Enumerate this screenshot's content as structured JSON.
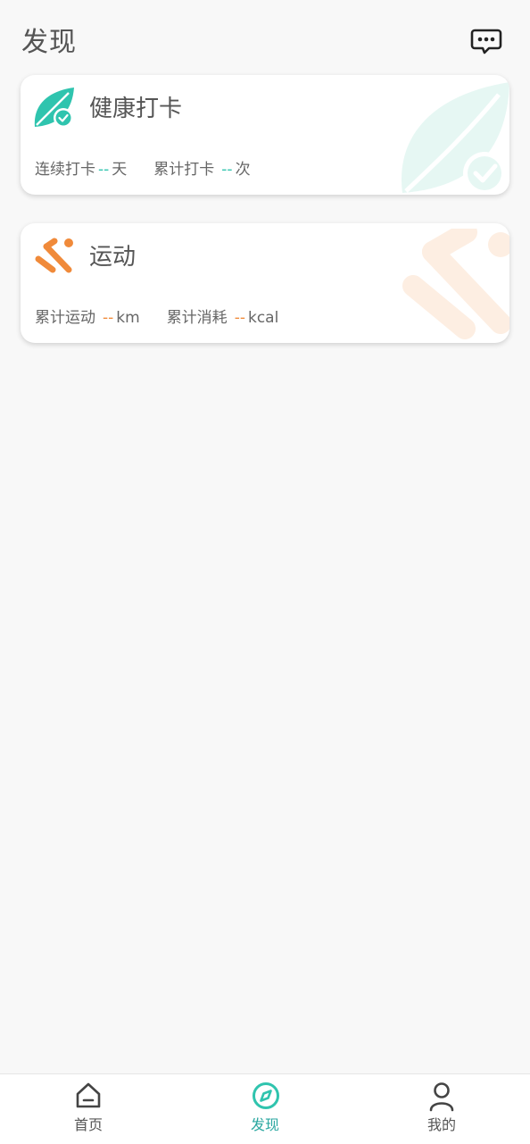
{
  "header": {
    "title": "发现",
    "message_icon": "chat-bubble-icon"
  },
  "cards": {
    "health": {
      "title": "健康打卡",
      "icon": "leaf-check-icon",
      "accent": "#2fc4ae",
      "stats": [
        {
          "label": "连续打卡",
          "value": "--",
          "unit": "天"
        },
        {
          "label": "累计打卡",
          "value": "--",
          "unit": "次"
        }
      ]
    },
    "sport": {
      "title": "运动",
      "icon": "running-icon",
      "accent": "#f08a3a",
      "stats": [
        {
          "label": "累计运动",
          "value": "--",
          "unit": "km"
        },
        {
          "label": "累计消耗",
          "value": "--",
          "unit": "kcal"
        }
      ]
    }
  },
  "tabbar": {
    "active": "发现",
    "active_color": "#2aa7a0",
    "items": [
      {
        "label": "首页",
        "icon": "home-icon"
      },
      {
        "label": "发现",
        "icon": "compass-icon"
      },
      {
        "label": "我的",
        "icon": "user-icon"
      }
    ]
  }
}
